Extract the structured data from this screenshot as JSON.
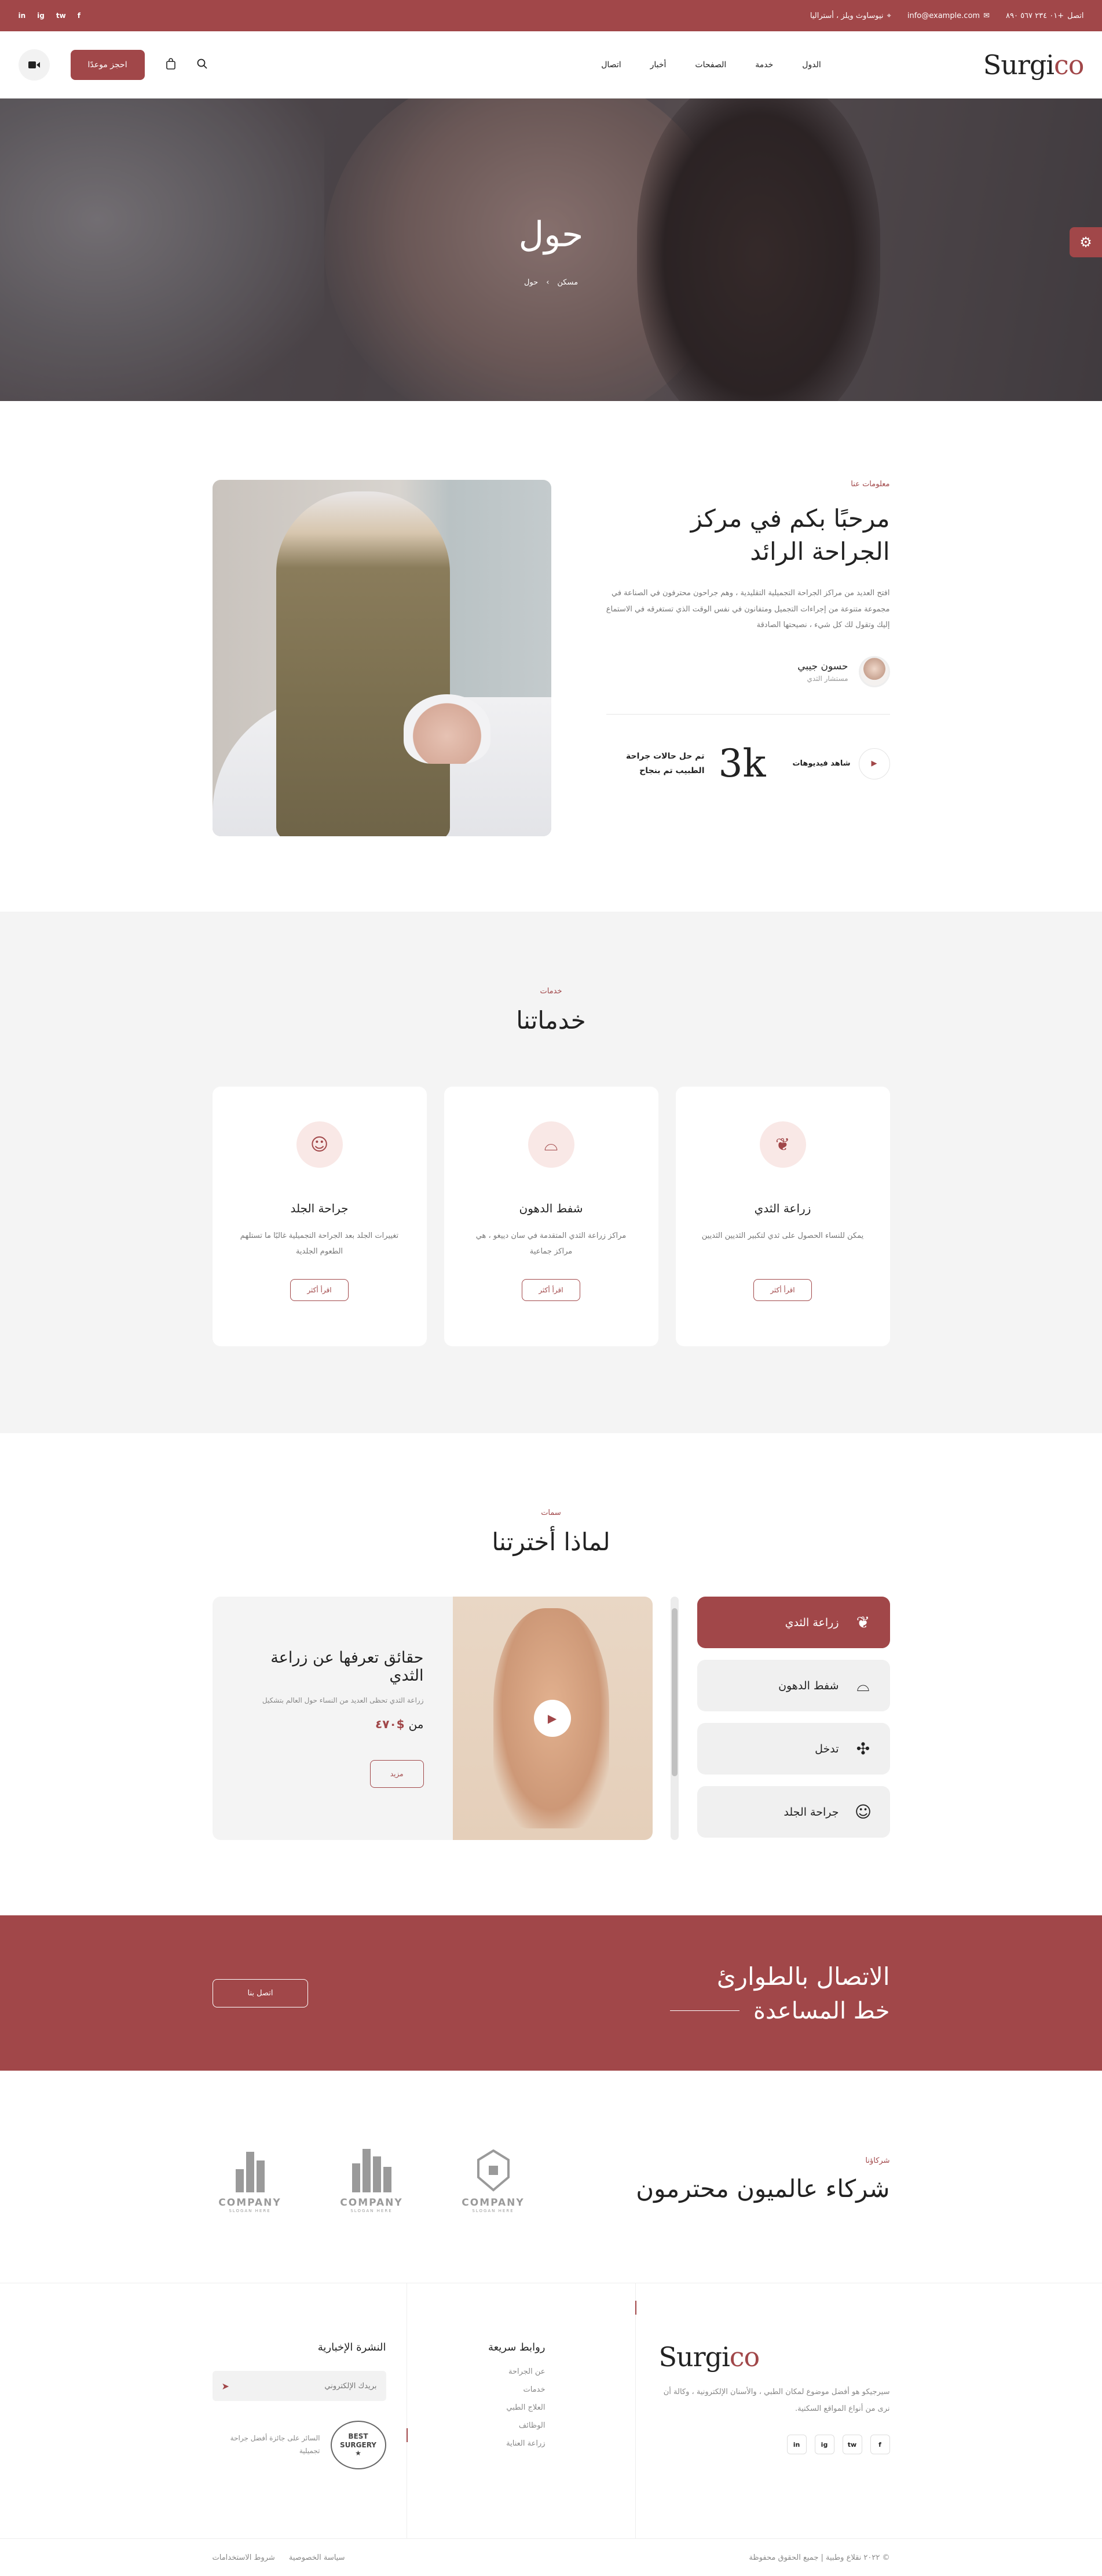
{
  "topbar": {
    "location": "نيوساوث ويلز ، أستراليا",
    "email": "info@example.com",
    "phone": "+٠١ ٢٣٤ ٥٦٧ ٨٩٠",
    "social": [
      "in",
      "ig",
      "tw",
      "f"
    ]
  },
  "header": {
    "logo_main": "Surgi",
    "logo_accent": "co",
    "nav": [
      "الدول",
      "خدمة",
      "الصفحات",
      "أخبار",
      "اتصال"
    ],
    "cta": "احجز موعدًا"
  },
  "hero": {
    "title": "حول",
    "crumb_home": "مسكن",
    "crumb_sep": "›",
    "crumb_current": "حول"
  },
  "about": {
    "eyebrow": "معلومات عنا",
    "title": "مرحبًا بكم في مركز الجراحة الرائد",
    "body": "افتح العديد من مراكز الجراحة التجميلية التقليدية ، وهم جراحون محترفون في الصناعة في مجموعة متنوعة من إجراءات التجميل ومتفانون في نفس الوقت الذي تستغرقه في الاستماع إليك وتقول لك كل شيء ، نصيحتها الصادقة",
    "author_name": "حسون جيبي",
    "author_role": "مستشار الثدي",
    "watch_label": "شاهد فيديوهات",
    "stat_value": "3k",
    "stat_label": "تم حل حالات جراحة الطبيب تم بنجاح"
  },
  "services": {
    "eyebrow": "خدمات",
    "title": "خدماتنا",
    "more_label": "اقرأ أكثر",
    "items": [
      {
        "icon": "breast-icon",
        "title": "زراعة الثدي",
        "desc": "يمكن للنساء الحصول على ثدي لتكبير الثديين الثديين"
      },
      {
        "icon": "body-icon",
        "title": "شفط الدهون",
        "desc": "مراكز زراعة الثدي المتقدمة في سان دييغو ، هي مراكز جماعية"
      },
      {
        "icon": "face-icon",
        "title": "جراحة الجلد",
        "desc": "تغييرات الجلد بعد الجراحة التجميلية غالبًا ما تستلهم الطعوم الجلدية"
      }
    ]
  },
  "why": {
    "eyebrow": "سمات",
    "title": "لماذا أخترتنا",
    "tabs": [
      {
        "icon": "breast-icon",
        "label": "زراعة الثدي"
      },
      {
        "icon": "body-icon",
        "label": "شفط الدهون"
      },
      {
        "icon": "syringe-icon",
        "label": "تدخل"
      },
      {
        "icon": "face-icon",
        "label": "جراحة الجلد"
      }
    ],
    "feature_title": "حقائق تعرفها عن زراعة الثدي",
    "feature_desc": "زراعة الثدي تحظى العديد من النساء حول العالم بتشكيل",
    "price_from": "من",
    "price_value": "$٤٧٠",
    "feature_btn": "مزيد"
  },
  "emergency": {
    "line1": "الاتصال بالطوارئ",
    "line2": "خط المساعدة",
    "btn": "اتصل بنا"
  },
  "partners": {
    "eyebrow": "شركاؤنا",
    "title": "شركاء عالميون محترمون",
    "logos": [
      {
        "word": "COMPANY",
        "tag": "SLOGAN HERE"
      },
      {
        "word": "COMPANY",
        "tag": "SLOGAN HERE"
      },
      {
        "word": "COMPANY",
        "tag": "SLOGAN HERE"
      }
    ]
  },
  "footer": {
    "logo_main": "Surgi",
    "logo_accent": "co",
    "about": "سيرجيكو هو أفضل موضوع لمكان الطبي ، والأسنان الإلكترونية ، وكالة أن نرى من أنواع المواقع السكنية.",
    "social": [
      "f",
      "tw",
      "ig",
      "in"
    ],
    "links_title": "روابط سريعة",
    "links": [
      "عن الجراحة",
      "خدمات",
      "العلاج الطبي",
      "الوظائف",
      "زراعة العناية"
    ],
    "news_title": "النشرة الإخبارية",
    "news_placeholder": "بريدك الإلكتروني",
    "badge_l1": "BEST",
    "badge_l2": "SURGERY",
    "badge_text": "السائر على جائزة أفضل جراحة تجميلية",
    "copyright": "© ٢٠٢٢ نقلاع وطبية | جميع الحقوق محفوظة",
    "legal": [
      "سياسة الخصوصية",
      "شروط الاستخدامات"
    ]
  }
}
